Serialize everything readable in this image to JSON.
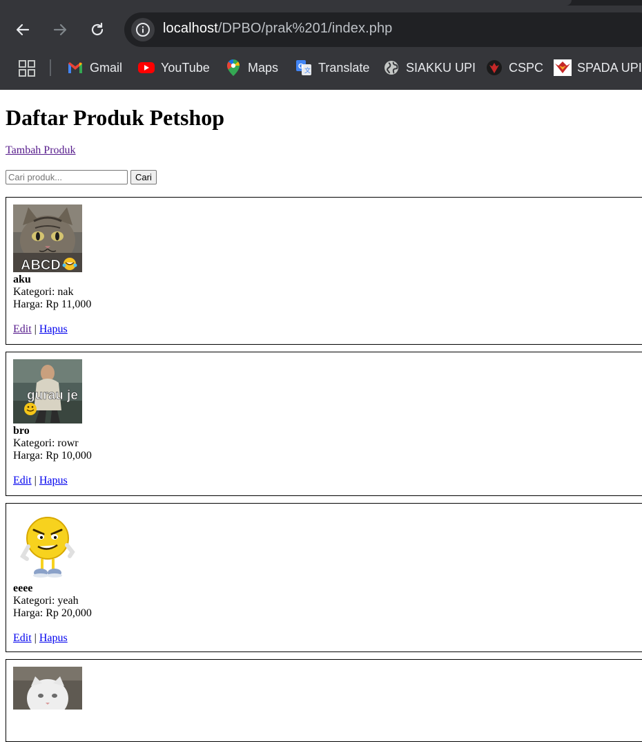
{
  "browser": {
    "url_host": "localhost",
    "url_path": "/DPBO/prak%201/index.php",
    "bookmarks": [
      {
        "label": "Gmail",
        "icon": "gmail-icon"
      },
      {
        "label": "YouTube",
        "icon": "youtube-icon"
      },
      {
        "label": "Maps",
        "icon": "maps-icon"
      },
      {
        "label": "Translate",
        "icon": "translate-icon"
      },
      {
        "label": "SIAKKU UPI",
        "icon": "globe-icon"
      },
      {
        "label": "CSPC",
        "icon": "cspc-icon"
      },
      {
        "label": "SPADA UPI",
        "icon": "spada-icon"
      }
    ]
  },
  "page": {
    "title": "Daftar Produk Petshop",
    "add_link": "Tambah Produk",
    "search": {
      "placeholder": "Cari produk...",
      "button": "Cari"
    },
    "products": [
      {
        "name": "aku",
        "kategori": "Kategori: nak",
        "harga": "Harga: Rp 11,000",
        "image_caption": "ABCD",
        "edit": "Edit",
        "separator": "|",
        "hapus": "Hapus"
      },
      {
        "name": "bro",
        "kategori": "Kategori: rowr",
        "harga": "Harga: Rp 10,000",
        "image_caption": "gurau je pun",
        "edit": "Edit",
        "separator": "|",
        "hapus": "Hapus"
      },
      {
        "name": "eeee",
        "kategori": "Kategori: yeah",
        "harga": "Harga: Rp 20,000",
        "edit": "Edit",
        "separator": "|",
        "hapus": "Hapus"
      }
    ]
  }
}
